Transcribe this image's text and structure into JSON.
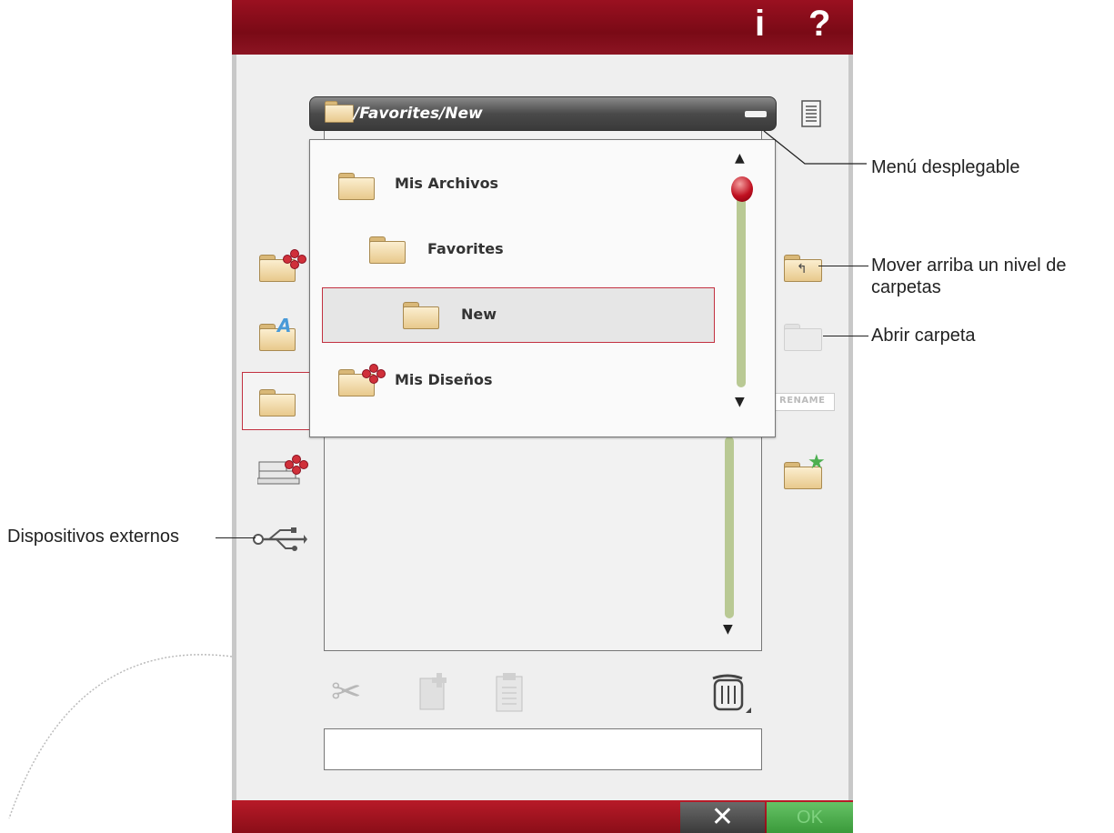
{
  "topbar": {
    "info_label": "i",
    "help_label": "?"
  },
  "path_bar": {
    "path": "/Favorites/New"
  },
  "dropdown": {
    "items": [
      {
        "label": "Mis Archivos"
      },
      {
        "label": "Favorites"
      },
      {
        "label": "New"
      },
      {
        "label": "Mis Diseños"
      }
    ]
  },
  "right_toolbar": {
    "rename_label": "RENAME"
  },
  "bottom_bar": {
    "cancel_label": "✕",
    "ok_label": "OK"
  },
  "annotations": {
    "dropdown_menu": "Menú desplegable",
    "up_level_line1": "Mover arriba un nivel de",
    "up_level_line2": "carpetas",
    "open_folder": "Abrir carpeta",
    "external_devices": "Dispositivos externos"
  },
  "colors": {
    "accent": "#8c1422",
    "selection_border": "#c23040",
    "ok_green": "#4caf50",
    "scroll_track": "#b9c994"
  }
}
